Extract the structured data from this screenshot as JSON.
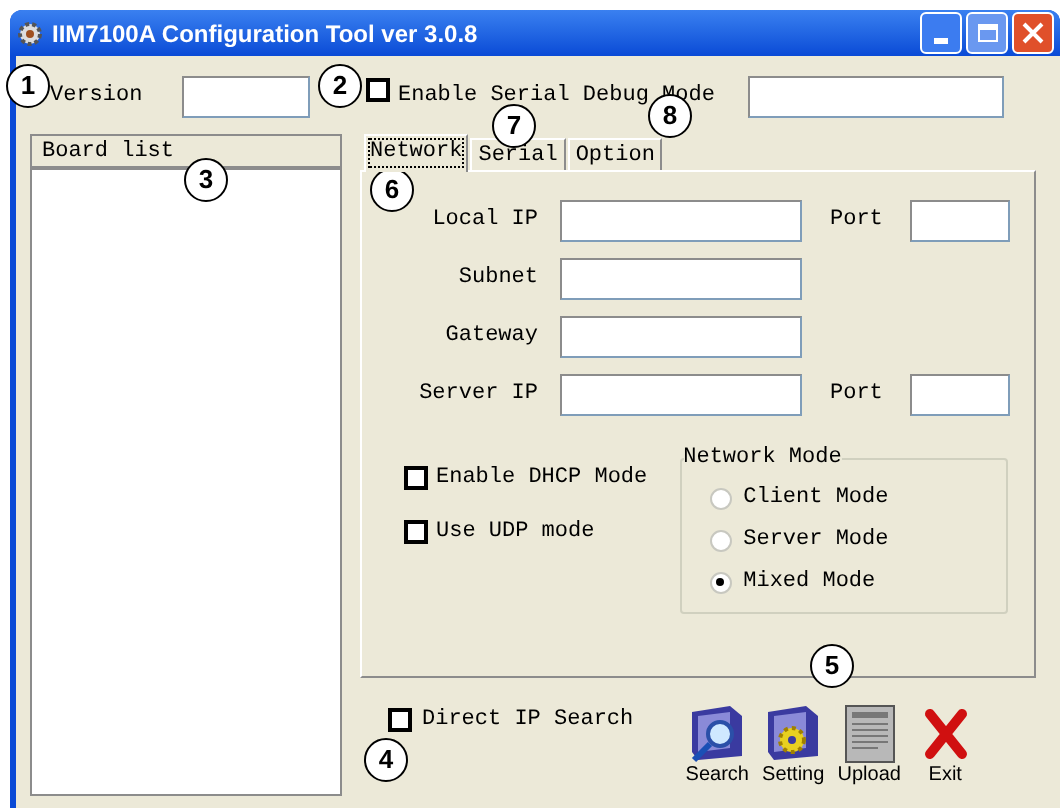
{
  "window": {
    "title": "IIM7100A Configuration Tool ver 3.0.8"
  },
  "version": {
    "label": "Version"
  },
  "serial_debug": {
    "label": "Enable Serial Debug Mode",
    "checked": false
  },
  "board_list": {
    "header": "Board list"
  },
  "tabs": [
    {
      "label": "Network",
      "selected": true
    },
    {
      "label": "Serial",
      "selected": false
    },
    {
      "label": "Option",
      "selected": false
    }
  ],
  "network": {
    "fields": [
      {
        "label": "Local IP",
        "port_label": "Port"
      },
      {
        "label": "Subnet"
      },
      {
        "label": "Gateway"
      },
      {
        "label": "Server IP",
        "port_label": "Port"
      }
    ],
    "options": [
      {
        "label": "Enable DHCP Mode",
        "checked": false
      },
      {
        "label": "Use UDP mode",
        "checked": false
      }
    ],
    "network_mode": {
      "title": "Network Mode",
      "options": [
        {
          "label": "Client Mode",
          "selected": false
        },
        {
          "label": "Server Mode",
          "selected": false
        },
        {
          "label": "Mixed Mode",
          "selected": true
        }
      ]
    }
  },
  "direct_ip_search": {
    "label": "Direct IP Search",
    "checked": false
  },
  "buttons": [
    {
      "label": "Search",
      "kind": "search"
    },
    {
      "label": "Setting",
      "kind": "setting"
    },
    {
      "label": "Upload",
      "kind": "upload"
    },
    {
      "label": "Exit",
      "kind": "exit"
    }
  ],
  "callouts": [
    "1",
    "2",
    "3",
    "4",
    "5",
    "6",
    "7",
    "8"
  ]
}
